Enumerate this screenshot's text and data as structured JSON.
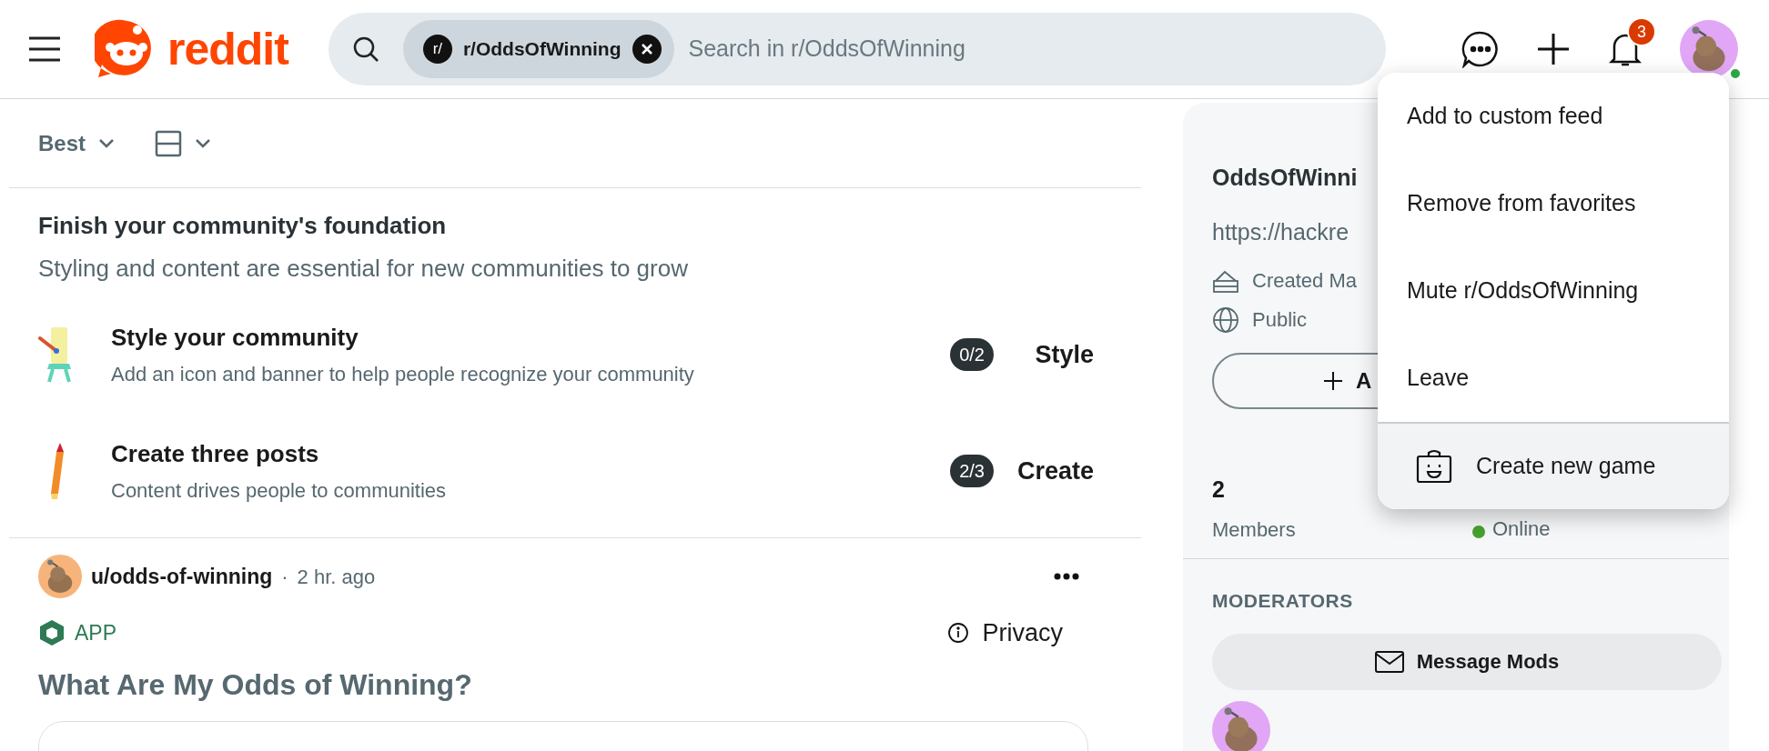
{
  "header": {
    "logo_text": "reddit",
    "search": {
      "chip_icon": "r/",
      "chip": "r/OddsOfWinning",
      "placeholder": "Search in r/OddsOfWinning"
    },
    "notification_count": "3"
  },
  "feed_controls": {
    "sort": "Best"
  },
  "foundation": {
    "title": "Finish your community's foundation",
    "subtitle": "Styling and content are essential for new communities to grow",
    "tasks": [
      {
        "kind": "style",
        "title": "Style your community",
        "description": "Add an icon and banner to help people recognize your community",
        "progress": "0/2",
        "action": "Style"
      },
      {
        "kind": "posts",
        "title": "Create three posts",
        "description": "Content drives people to communities",
        "progress": "2/3",
        "action": "Create"
      }
    ]
  },
  "post": {
    "author": "u/odds-of-winning",
    "separator": "·",
    "time": "2 hr. ago",
    "app_label": "APP",
    "privacy": "Privacy",
    "title": "What Are My Odds of Winning?"
  },
  "sidebar": {
    "name": "OddsOfWinni",
    "url": "https://hackre",
    "created": "Created Ma",
    "visibility": "Public",
    "join_button": "A",
    "members_count": "2",
    "members_label": "Members",
    "online_label": "Online",
    "moderators_heading": "MODERATORS",
    "message_button": "Message Mods"
  },
  "menu": {
    "items": [
      {
        "kind": "plain",
        "label": "Add to custom feed",
        "selected": false
      },
      {
        "kind": "plain",
        "label": "Remove from favorites",
        "selected": false
      },
      {
        "kind": "plain",
        "label": "Mute r/OddsOfWinning",
        "selected": false
      },
      {
        "kind": "plain",
        "label": "Leave",
        "selected": false
      },
      {
        "kind": "game",
        "label": "Create new game",
        "selected": true
      }
    ]
  }
}
